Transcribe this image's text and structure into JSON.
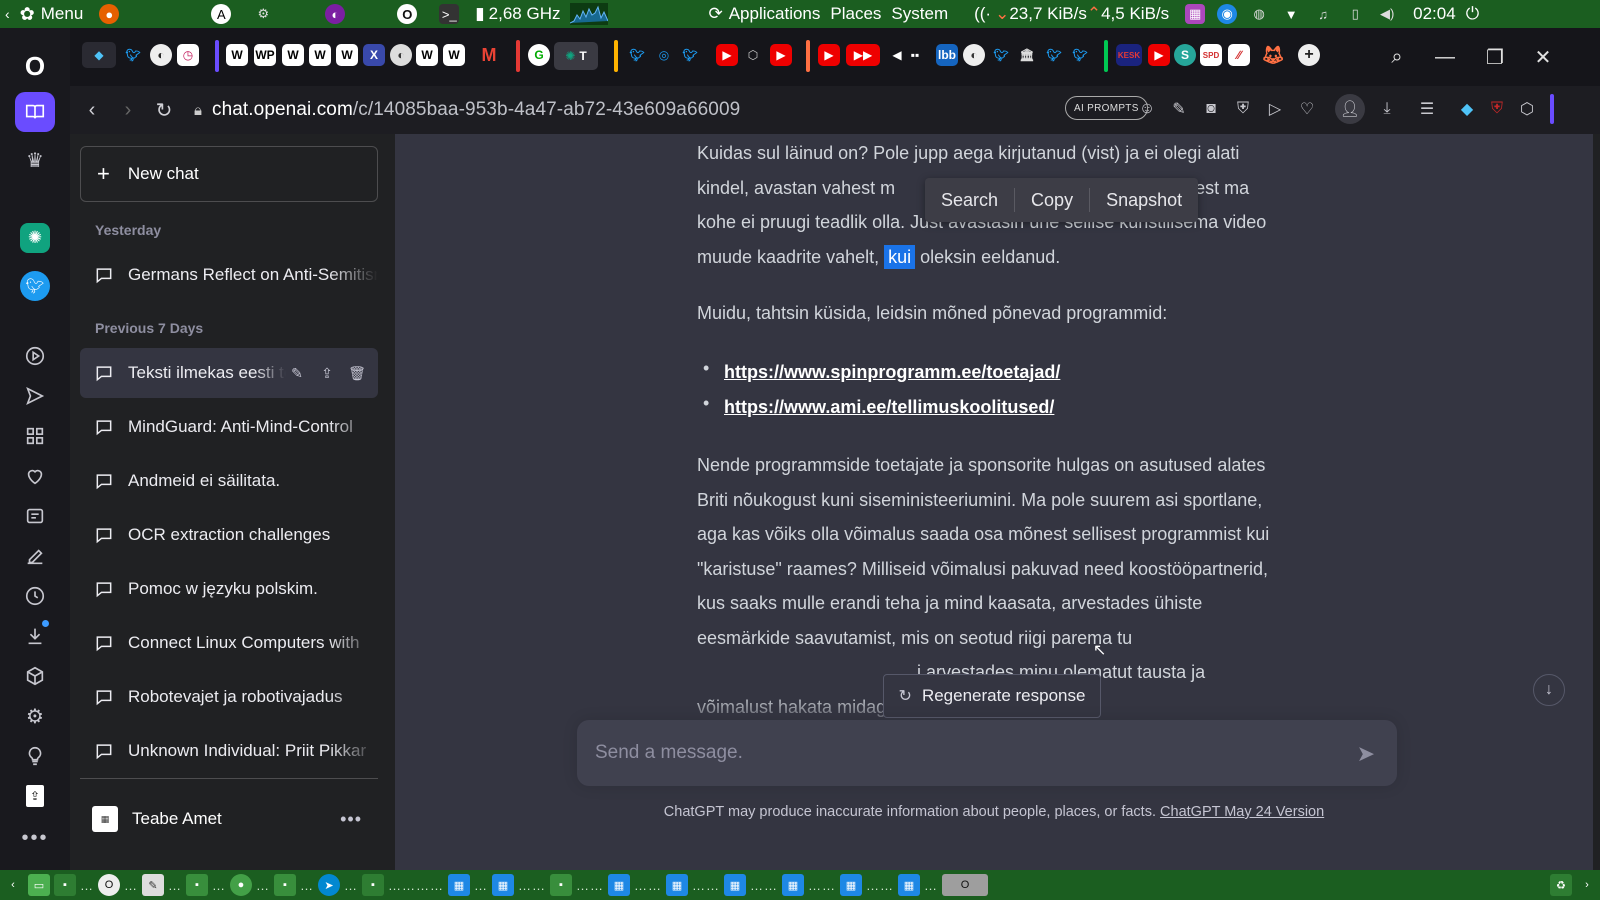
{
  "system_panel": {
    "menu_label": "Menu",
    "cpu_freq": "2,68 GHz",
    "apps_menu": "Applications",
    "places_menu": "Places",
    "system_menu": "System",
    "net_down": "23,7 KiB/s",
    "net_up": "4,5 KiB/s",
    "clock": "02:04"
  },
  "browser": {
    "url_domain": "chat.openai.com",
    "url_path": "/c/14085baa-953b-4a47-ab72-43e609a66009",
    "ai_prompts_label": "AI PROMPTS"
  },
  "sidebar": {
    "new_chat_label": "New chat",
    "groups": [
      {
        "label": "Yesterday",
        "items": [
          "Germans Reflect on Anti-Semitism"
        ]
      },
      {
        "label": "Previous 7 Days",
        "items": [
          "Teksti ilmekas eesti tõlge",
          "MindGuard: Anti-Mind-Control",
          "Andmeid ei säilitata.",
          "OCR extraction challenges",
          "Pomoc w języku polskim.",
          "Connect Linux Computers with",
          "Robotevajet ja robotivajadus",
          "Unknown Individual: Priit Pikkar"
        ]
      }
    ],
    "user_name": "Teabe Amet"
  },
  "chat": {
    "para1_a": "Kuidas sul läinud on? Pole jupp aega kirjutanud (vist) ja ei olegi alati kindel, avastan vahest m",
    "para1_b": "est ma kohe ei pruugi teadlik olla. Just avastasin ühe sellise kunstilisema video muude kaadrite vahelt, ",
    "para1_highlight": "kui",
    "para1_c": " oleksin eeldanud.",
    "para2": "Muidu, tahtsin küsida, leidsin mõned põnevad programmid:",
    "links": [
      "https://www.spinprogramm.ee/toetajad/",
      "https://www.ami.ee/tellimuskoolitused/"
    ],
    "para3": "Nende programmside toetajate ja sponsorite hulgas on asutused alates Briti nõukogust kuni siseministeeriumini. Ma pole suurem asi sportlane, aga kas võiks olla võimalus saada osa mõnest sellisest programmist kui \"karistuse\" raames? Milliseid võimalusi pakuvad need koostööpartnerid, kus saaks mulle erandi teha ja mind kaasata, arvestades ühiste eesmärkide saavutamist, mis on seotud riigi parema tu",
    "para3_tail": "i arvestades minu olematut tausta ja võimalust hakata midagi visakamat üles",
    "context_menu": [
      "Search",
      "Copy",
      "Snapshot"
    ],
    "regenerate_label": "Regenerate response",
    "input_placeholder": "Send a message.",
    "disclaimer": "ChatGPT may produce inaccurate information about people, places, or facts. ",
    "version_link": "ChatGPT May 24 Version"
  },
  "colors": {
    "panel_green": "#1b5e20",
    "sidebar_bg": "#202123",
    "main_bg": "#343541",
    "input_bg": "#40414f",
    "selection_blue": "#1a73e8"
  }
}
